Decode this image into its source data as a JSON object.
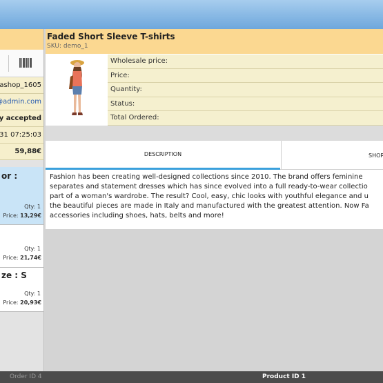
{
  "order_panel": {
    "info": [
      "ashop_1605",
      "@admin.com",
      "ely accepted",
      "31 07:25:03",
      "59,88€"
    ],
    "items": [
      {
        "title": "or :",
        "qty": "Qty: 1",
        "price_label": "Price:",
        "price": "13,29€"
      },
      {
        "title": "",
        "qty": "Qty: 1",
        "price_label": "Price:",
        "price": "21,74€"
      },
      {
        "title": "ze : S",
        "qty": "Qty: 1",
        "price_label": "Price:",
        "price": "20,93€"
      }
    ]
  },
  "product": {
    "title": "Faded Short Sleeve T-shirts",
    "sku_label": "SKU:",
    "sku": "demo_1",
    "fields": [
      "Wholesale price:",
      "Price:",
      "Quantity:",
      "Status:",
      "Total Ordered:"
    ],
    "tabs": [
      "DESCRIPTION",
      "SHOR"
    ],
    "description": [
      "Fashion has been creating well-designed collections since 2010. The brand offers feminine",
      "separates and statement dresses which has since evolved into a full ready-to-wear collectio",
      "part of a woman's wardrobe. The result? Cool, easy, chic looks with youthful elegance and u",
      "the beautiful pieces are made in Italy and manufactured with the greatest attention. Now Fa",
      "accessories including shoes, hats, belts and more!"
    ]
  },
  "footer": {
    "left": "Order ID 4",
    "right": "Product ID 1"
  },
  "colors": {
    "header": "#fbd891",
    "selected": "#c9e4f7",
    "tab_indicator": "#3aa0dc",
    "link": "#2a5db0"
  }
}
